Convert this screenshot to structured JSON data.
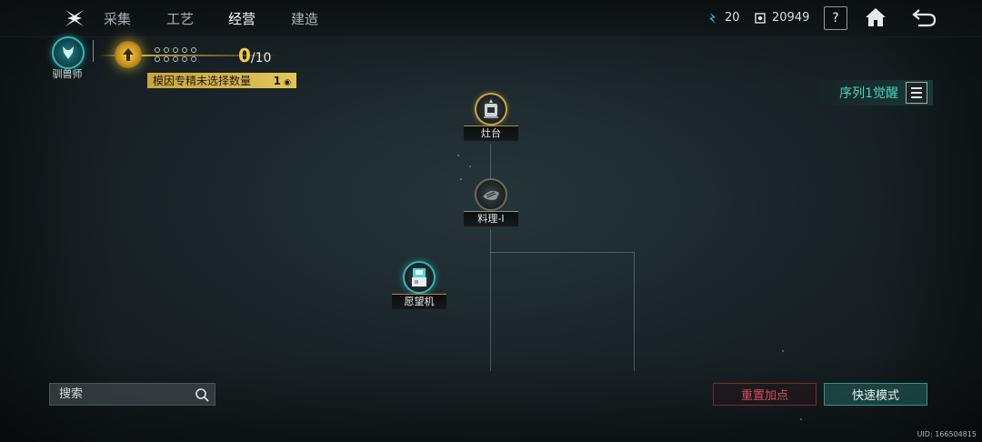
{
  "nav": {
    "tabs": [
      {
        "label": "采集"
      },
      {
        "label": "工艺"
      },
      {
        "label": "经营"
      },
      {
        "label": "建造"
      }
    ],
    "active_tab": "经营"
  },
  "resources": {
    "energy": {
      "value": "20",
      "icon": "energy-icon"
    },
    "currency": {
      "value": "20949",
      "icon": "gear-currency-icon"
    }
  },
  "topbar_buttons": {
    "help_label": "?"
  },
  "profile": {
    "role": "驯兽师",
    "icon": "wolf-icon"
  },
  "gene_mastery": {
    "current": "0",
    "max": "/10",
    "notice_text": "模因专精未选择数量",
    "notice_count": "1"
  },
  "sequence": {
    "label": "序列1觉醒"
  },
  "tree_nodes": [
    {
      "name": "灶台",
      "icon": "stove-icon"
    },
    {
      "name": "料理-I",
      "icon": "cooking-icon"
    },
    {
      "name": "愿望机",
      "icon": "wish-machine-icon"
    }
  ],
  "search": {
    "placeholder": "搜索"
  },
  "actions": {
    "reset_label": "重置加点",
    "fast_label": "快速模式"
  },
  "uid": "UID: 166504815",
  "colors": {
    "gold": "#c9a53e",
    "teal": "#2fb7bd",
    "red": "#d64e5f",
    "accent_text": "#49d3b5"
  }
}
